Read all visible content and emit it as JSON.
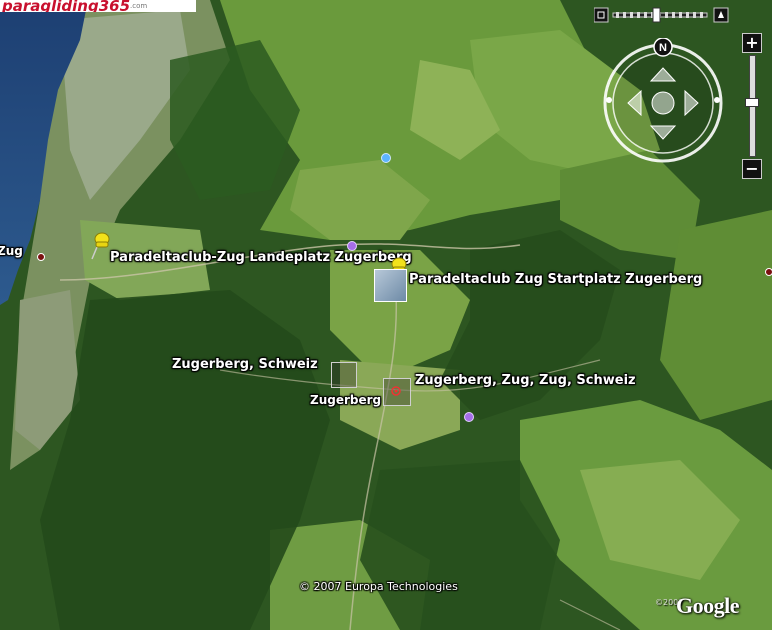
{
  "logo": {
    "part1": "paragliding",
    "part2": "365",
    "part3": ".com"
  },
  "places": {
    "landeplatz": "Paradeltaclub-Zug Landeplatz Zugerberg",
    "startplatz": "Paradeltaclub Zug Startplatz Zugerberg",
    "zugerberg_schweiz": "Zugerberg, Schweiz",
    "zugerberg": "Zugerberg",
    "zugerberg_zug": "Zugerberg, Zug, Zug, Schweiz",
    "zug": "Zug"
  },
  "nav": {
    "north": "N"
  },
  "zoom": {
    "plus": "+",
    "minus": "−"
  },
  "copyright": "© 2007 Europa Technologies",
  "copyright_year": "©2007",
  "brand": "Google",
  "colors": {
    "pin": "#f2e21b",
    "water": "#2b4f86",
    "forest": "#2f5a22",
    "field": "#6e9a3f"
  }
}
